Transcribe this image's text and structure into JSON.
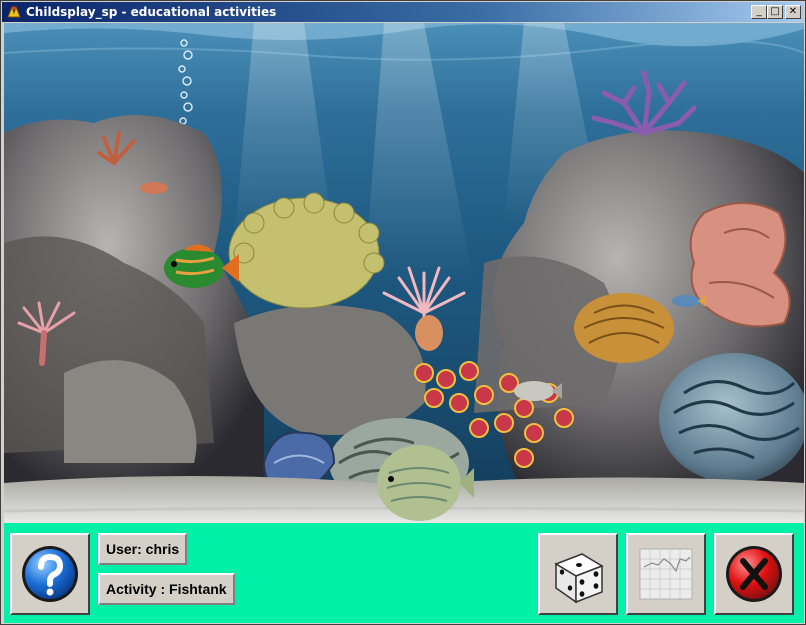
{
  "window": {
    "title": "Childsplay_sp - educational activities",
    "buttons": {
      "minimize": "_",
      "maximize": "□",
      "close": "✕"
    }
  },
  "status": {
    "user": "User: chris",
    "activity": "Activity : Fishtank"
  },
  "toolbar": {
    "help_icon": "question-mark-icon",
    "dice_icon": "dice-icon",
    "graph_icon": "graph-icon",
    "quit_icon": "quit-x-icon"
  },
  "colors": {
    "toolbar_bg": "#00f0a8",
    "water_top": "#4a8fb8",
    "water_bottom": "#123a58",
    "help_blue": "#1a6fd8",
    "quit_red": "#e01010"
  }
}
